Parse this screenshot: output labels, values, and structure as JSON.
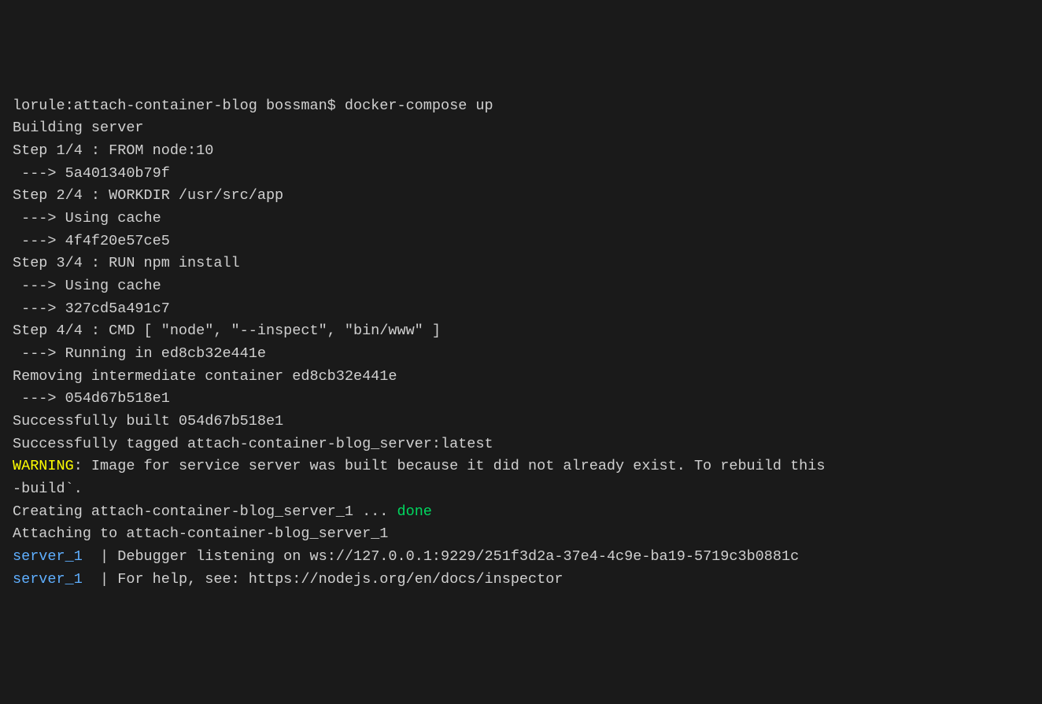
{
  "terminal": {
    "prompt_line": "lorule:attach-container-blog bossman$ docker-compose up",
    "lines": [
      "Building server",
      "Step 1/4 : FROM node:10",
      " ---> 5a401340b79f",
      "Step 2/4 : WORKDIR /usr/src/app",
      " ---> Using cache",
      " ---> 4f4f20e57ce5",
      "Step 3/4 : RUN npm install",
      " ---> Using cache",
      " ---> 327cd5a491c7",
      "Step 4/4 : CMD [ \"node\", \"--inspect\", \"bin/www\" ]",
      " ---> Running in ed8cb32e441e",
      "Removing intermediate container ed8cb32e441e",
      " ---> 054d67b518e1",
      "",
      "Successfully built 054d67b518e1",
      "Successfully tagged attach-container-blog_server:latest"
    ],
    "warning": {
      "label": "WARNING",
      "text": ": Image for service server was built because it did not already exist. To rebuild this",
      "continuation": "-build`."
    },
    "creating": {
      "prefix": "Creating attach-container-blog_server_1 ... ",
      "status": "done"
    },
    "attaching": "Attaching to attach-container-blog_server_1",
    "server_lines": [
      {
        "label": "server_1  ",
        "sep": "| ",
        "text": "Debugger listening on ws://127.0.0.1:9229/251f3d2a-37e4-4c9e-ba19-5719c3b0881c"
      },
      {
        "label": "server_1  ",
        "sep": "| ",
        "text": "For help, see: https://nodejs.org/en/docs/inspector"
      }
    ]
  }
}
